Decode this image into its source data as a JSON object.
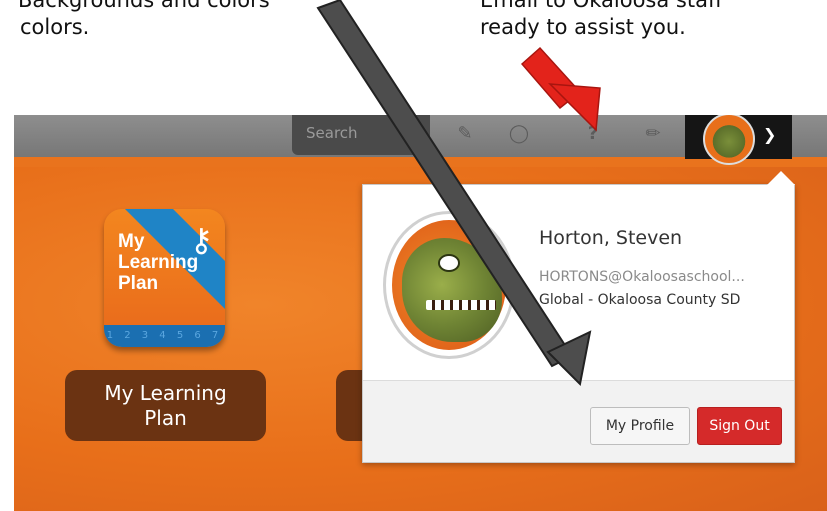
{
  "captions": {
    "left_line1": "Backgrounds and colors",
    "left_line2": "colors.",
    "right_line1": "Email to Okaloosa staff",
    "right_line2": "ready to assist you."
  },
  "topbar": {
    "search_placeholder": "Search",
    "icons": [
      "pencil-square-icon",
      "bell-icon",
      "question-icon",
      "pencil-icon"
    ],
    "question_glyph": "?",
    "chevron_glyph": "⌄"
  },
  "app": {
    "icon_text_line1": "My",
    "icon_text_line2": "Learning",
    "icon_text_line3": "Plan",
    "strip_numbers": "1 2 3 4 5 6 7",
    "button_label_line1": "My Learning",
    "button_label_line2": "Plan"
  },
  "profile": {
    "name": "Horton, Steven",
    "email": "HORTONS@Okaloosaschool...",
    "organization": "Global - Okaloosa County SD",
    "my_profile_label": "My Profile",
    "sign_out_label": "Sign Out"
  },
  "colors": {
    "brand_orange": "#e9731d",
    "sign_out_red": "#d52a2a",
    "annotation_red": "#e3231b",
    "annotation_gray": "#4d4d4d"
  }
}
